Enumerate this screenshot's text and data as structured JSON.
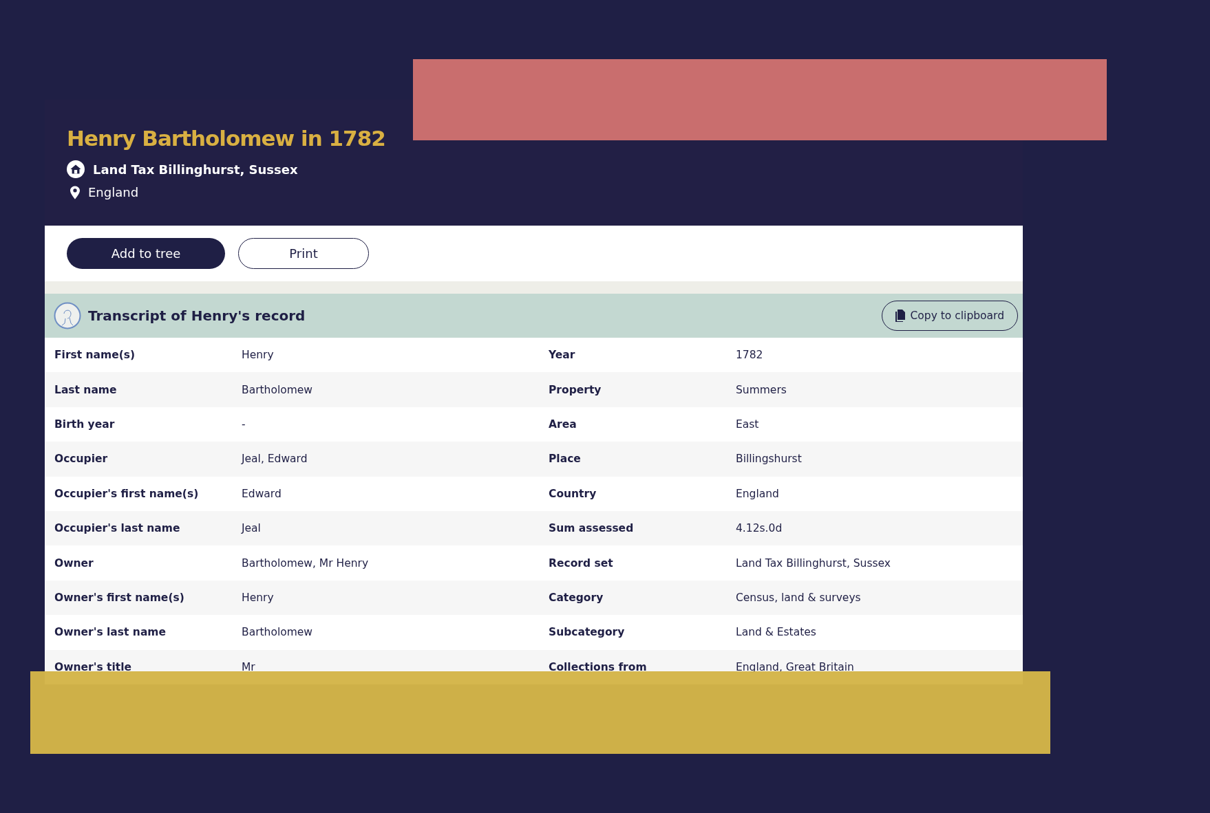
{
  "header": {
    "title": "Henry Bartholomew in 1782",
    "record_set": "Land Tax Billinghurst, Sussex",
    "location": "England"
  },
  "actions": [
    {
      "label": "Add to tree",
      "kind": "primary"
    },
    {
      "label": "Print",
      "kind": "secondary"
    }
  ],
  "transcript": {
    "title": "Transcript of Henry's record",
    "copy_button": "Copy to clipboard",
    "rows": [
      {
        "label": "First name(s)",
        "value": "Henry",
        "label_2": "Year",
        "value_2": "1782"
      },
      {
        "label": "Last name",
        "value": "Bartholomew",
        "label_2": "Property",
        "value_2": "Summers"
      },
      {
        "label": "Birth year",
        "value": "-",
        "label_2": "Area",
        "value_2": "East"
      },
      {
        "label": "Occupier",
        "value": "Jeal, Edward",
        "label_2": "Place",
        "value_2": "Billingshurst"
      },
      {
        "label": "Occupier's first name(s)",
        "value": "Edward",
        "label_2": "Country",
        "value_2": "England"
      },
      {
        "label": "Occupier's last name",
        "value": "Jeal",
        "label_2": "Sum assessed",
        "value_2": "4.12s.0d"
      },
      {
        "label": "Owner",
        "value": "Bartholomew, Mr Henry",
        "label_2": "Record set",
        "value_2": "Land Tax Billinghurst, Sussex"
      },
      {
        "label": "Owner's first name(s)",
        "value": "Henry",
        "label_2": "Category",
        "value_2": "Census, land & surveys"
      },
      {
        "label": "Owner's last name",
        "value": "Bartholomew",
        "label_2": "Subcategory",
        "value_2": "Land & Estates"
      },
      {
        "label": "Owner's title",
        "value": "Mr",
        "label_2": "Collections from",
        "value_2": "England, Great Britain"
      }
    ]
  }
}
